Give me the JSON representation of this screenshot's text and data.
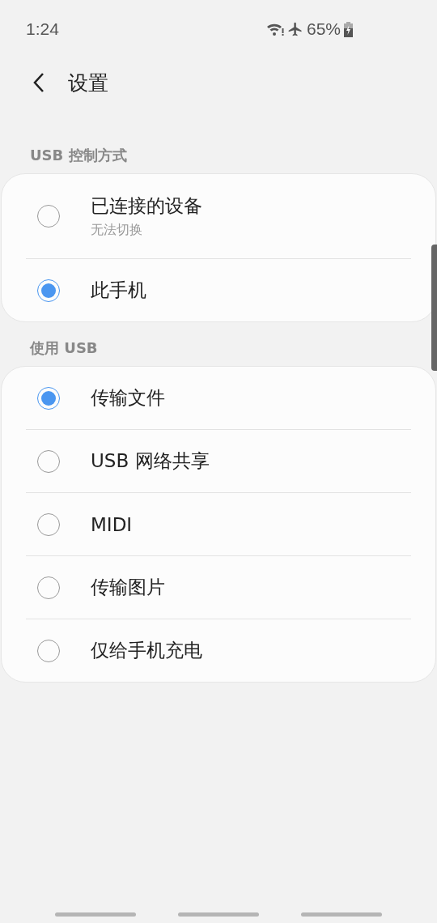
{
  "status_bar": {
    "time": "1:24",
    "battery": "65%"
  },
  "header": {
    "title": "设置"
  },
  "sections": [
    {
      "title": "USB 控制方式",
      "options": [
        {
          "label": "已连接的设备",
          "subtitle": "无法切换",
          "selected": false
        },
        {
          "label": "此手机",
          "selected": true
        }
      ]
    },
    {
      "title": "使用 USB",
      "options": [
        {
          "label": "传输文件",
          "selected": true
        },
        {
          "label": "USB 网络共享",
          "selected": false
        },
        {
          "label": "MIDI",
          "selected": false
        },
        {
          "label": "传输图片",
          "selected": false
        },
        {
          "label": "仅给手机充电",
          "selected": false
        }
      ]
    }
  ]
}
